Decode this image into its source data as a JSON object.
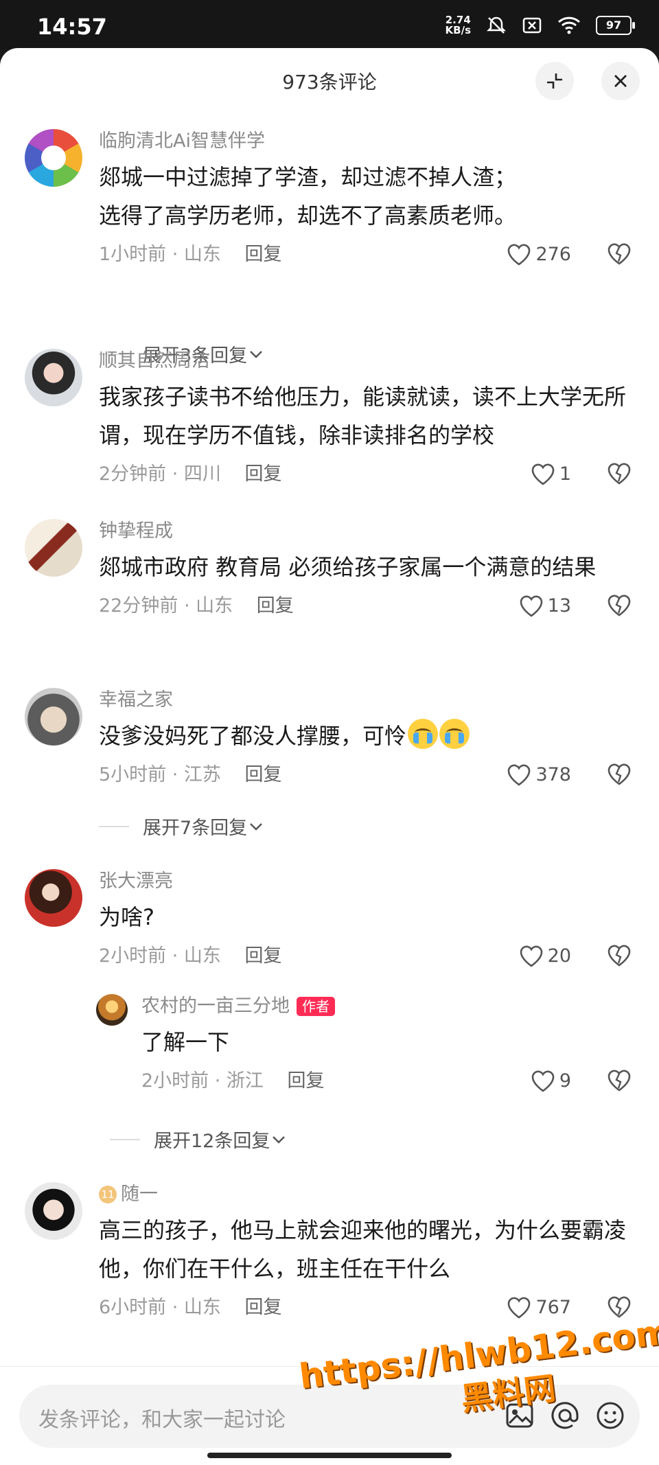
{
  "status_bar": {
    "time": "14:57",
    "net_speed_value": "2.74",
    "net_speed_unit": "KB/s",
    "battery": "97"
  },
  "header": {
    "title": "973条评论",
    "collapse_icon": "collapse-icon",
    "close_icon": "close-icon"
  },
  "comments": [
    {
      "user": "临朐清北Ai智慧伴学",
      "text": "郯城一中过滤掉了学渣，却过滤不掉人渣；\n选得了高学历老师，却选不了高素质老师。",
      "time": "1小时前 · 山东",
      "reply": "回复",
      "likes": "276",
      "expand": "展开3条回复"
    },
    {
      "user": "顺其自然周洁",
      "text": "我家孩子读书不给他压力，能读就读，读不上大学无所谓，现在学历不值钱，除非读排名的学校",
      "time": "2分钟前 · 四川",
      "reply": "回复",
      "likes": "1"
    },
    {
      "user": "钟挚程成",
      "text": "郯城市政府 教育局 必须给孩子家属一个满意的结果",
      "time": "22分钟前 · 山东",
      "reply": "回复",
      "likes": "13"
    },
    {
      "user": "幸福之家",
      "text": "没爹没妈死了都没人撑腰，可怜",
      "emoji": "crying-emoji",
      "time": "5小时前 · 江苏",
      "reply": "回复",
      "likes": "378",
      "expand": "展开7条回复"
    },
    {
      "user": "张大漂亮",
      "text": "为啥?",
      "time": "2小时前 · 山东",
      "reply": "回复",
      "likes": "20",
      "sub_reply": {
        "user": "农村的一亩三分地",
        "badge": "作者",
        "text": "了解一下",
        "time": "2小时前 · 浙江",
        "reply": "回复",
        "likes": "9"
      },
      "expand": "展开12条回复"
    },
    {
      "user": "随一",
      "level_badge": "11",
      "text": "高三的孩子，他马上就会迎来他的曙光，为什么要霸凌他，你们在干什么，班主任在干什么",
      "time": "6小时前 · 山东",
      "reply": "回复",
      "likes": "767"
    }
  ],
  "input": {
    "placeholder": "发条评论，和大家一起讨论",
    "image_icon": "image-icon",
    "mention_icon": "at-icon",
    "emoji_icon": "emoji-icon"
  },
  "watermark": {
    "url": "https://hlwb12.com",
    "name": "黑料网"
  },
  "colors": {
    "author_badge": "#fe2c55",
    "watermark": "#ff8a00"
  }
}
